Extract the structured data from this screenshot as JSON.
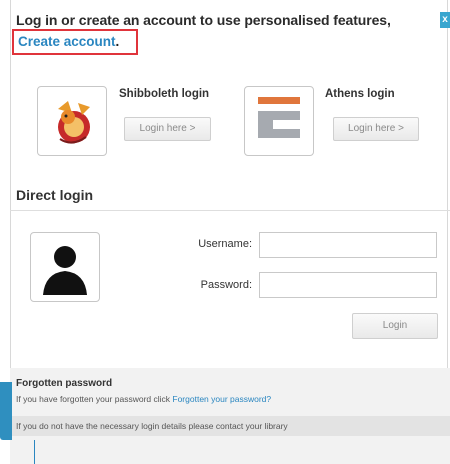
{
  "header": {
    "heading": "Log in or create an account to use personalised features,",
    "create_account": "Create account",
    "create_account_suffix": ".",
    "close_label": "x"
  },
  "shibboleth": {
    "title": "Shibboleth login",
    "button": "Login here >",
    "logo_icon": "shibboleth-dragon-icon"
  },
  "athens": {
    "title": "Athens login",
    "button": "Login here >",
    "logo_icon": "athens-logo-icon"
  },
  "direct": {
    "title": "Direct login",
    "avatar_icon": "user-silhouette-icon",
    "username_label": "Username:",
    "password_label": "Password:",
    "username_value": "",
    "password_value": "",
    "login_button": "Login"
  },
  "footer": {
    "forgot_title": "Forgotten password",
    "forgot_text": "If you have forgotten your password click ",
    "forgot_link": "Forgotten your password?",
    "library_text": "If you do not have the necessary login details please contact your library"
  },
  "colors": {
    "link": "#2a86c0",
    "highlight_border": "#e0343b",
    "athens_orange": "#e0763c",
    "athens_grey": "#a6aab0",
    "side_tab": "#2f8fbf"
  }
}
